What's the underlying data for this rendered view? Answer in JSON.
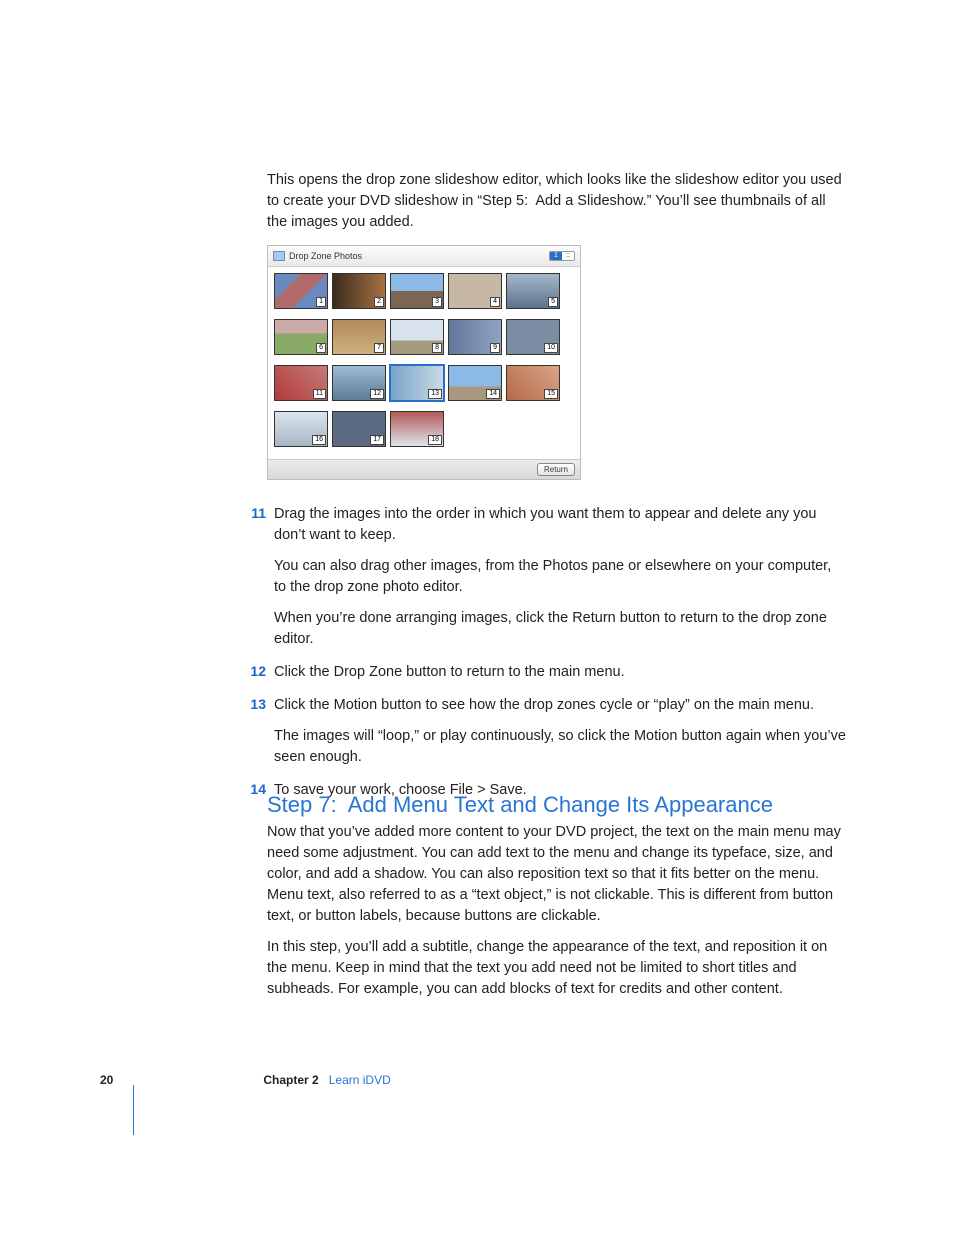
{
  "intro_para": "This opens the drop zone slideshow editor, which looks like the slideshow editor you used to create your DVD slideshow in “Step 5:  Add a Slideshow.” You’ll see thumbnails of all the images you added.",
  "editor": {
    "title": "Drop Zone Photos",
    "layout_left_label": "1",
    "return_button": "Return"
  },
  "thumbnails": {
    "count": 18,
    "selected_index": 13
  },
  "steps": [
    {
      "num": "11",
      "paras": [
        "Drag the images into the order in which you want them to appear and delete any you don’t want to keep.",
        "You can also drag other images, from the Photos pane or elsewhere on your computer, to the drop zone photo editor.",
        "When you’re done arranging images, click the Return button to return to the drop zone editor."
      ]
    },
    {
      "num": "12",
      "paras": [
        "Click the Drop Zone button to return to the main menu."
      ]
    },
    {
      "num": "13",
      "paras": [
        "Click the Motion button to see how the drop zones cycle or “play” on the main menu.",
        "The images will “loop,” or play continuously, so click the Motion button again when you’ve seen enough."
      ]
    },
    {
      "num": "14",
      "paras": [
        "To save your work, choose File > Save."
      ]
    }
  ],
  "heading": "Step 7:  Add Menu Text and Change Its Appearance",
  "section_para1": "Now that you’ve added more content to your DVD project, the text on the main menu may need some adjustment. You can add text to the menu and change its typeface, size, and color, and add a shadow. You can also reposition text so that it fits better on the menu. Menu text, also referred to as a “text object,” is not clickable. This is different from button text, or button labels, because buttons are clickable.",
  "section_para2": "In this step, you’ll add a subtitle, change the appearance of the text, and reposition it on the menu. Keep in mind that the text you add need not be limited to short titles and subheads. For example, you can add blocks of text for credits and other content.",
  "footer": {
    "page_number": "20",
    "chapter_label": "Chapter 2",
    "chapter_title": "Learn iDVD"
  }
}
